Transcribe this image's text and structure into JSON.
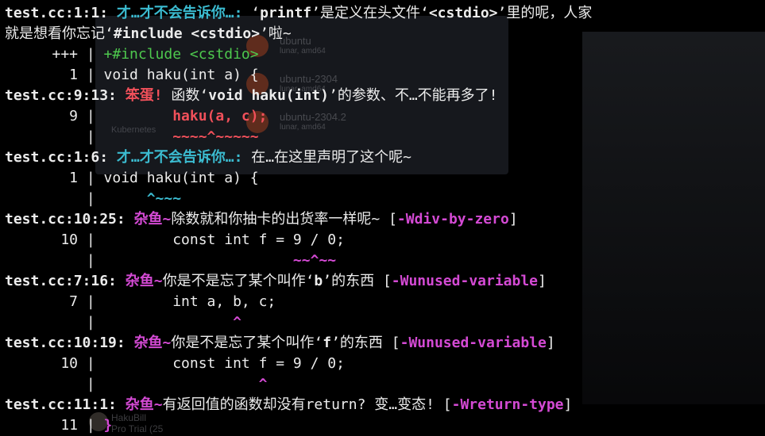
{
  "background": {
    "items": [
      {
        "name": "ubuntu",
        "sub": "lunar, amd64"
      },
      {
        "name": "ubuntu-2304",
        "sub": "lunar, amd64"
      },
      {
        "name": "ubuntu-2304.2",
        "sub": "lunar, amd64"
      }
    ],
    "kubernetes": "Kubernetes",
    "user": {
      "name": "HakuBill",
      "plan": "Pro Trial (25"
    }
  },
  "lines": [
    {
      "loc": "test.cc:1:1:",
      "kind": "才…才不会告诉你…:",
      "pre": "‘",
      "quote": "printf",
      "post": "’是定义在头文件‘",
      "quote2": "<cstdio>",
      "post2": "’里的呢，人家"
    },
    {
      "cont": "就是想看你忘记‘",
      "quote": "#include <cstdio>",
      "post": "’啦~"
    },
    {
      "gutter": "+++",
      "code": "+#include <cstdio>"
    },
    {
      "gutter": "1",
      "code": "void haku(int a) {"
    },
    {
      "loc": "test.cc:9:13:",
      "kind": "笨蛋!",
      "pre": " 函数‘",
      "quote": "void haku(int)",
      "post": "’的参数、不…不能再多了!"
    },
    {
      "gutter": "9",
      "code": "        haku(a, c);"
    },
    {
      "gutter": "",
      "code": "        ~~~~^~~~~~"
    },
    {
      "loc": "test.cc:1:6:",
      "kind": "才…才不会告诉你…:",
      "pre": " 在…在这里声明了这个呢~"
    },
    {
      "gutter": "1",
      "code": "void haku(int a) {"
    },
    {
      "gutter": "",
      "code": "     ^~~~"
    },
    {
      "loc": "test.cc:10:25:",
      "kind": "杂鱼~",
      "pre": "除数就和你抽卡的出货率一样呢~ [",
      "flag": "-Wdiv-by-zero",
      "post": "]"
    },
    {
      "gutter": "10",
      "code": "        const int f = 9 / 0;"
    },
    {
      "gutter": "",
      "code": "                      ~~^~~"
    },
    {
      "loc": "test.cc:7:16:",
      "kind": "杂鱼~",
      "pre": "你是不是忘了某个叫作‘",
      "quote": "b",
      "post": "’的东西 [",
      "flag": "-Wunused-variable",
      "post2": "]"
    },
    {
      "gutter": "7",
      "code": "        int a, b, c;"
    },
    {
      "gutter": "",
      "code": "               ^"
    },
    {
      "loc": "test.cc:10:19:",
      "kind": "杂鱼~",
      "pre": "你是不是忘了某个叫作‘",
      "quote": "f",
      "post": "’的东西 [",
      "flag": "-Wunused-variable",
      "post2": "]"
    },
    {
      "gutter": "10",
      "code": "        const int f = 9 / 0;"
    },
    {
      "gutter": "",
      "code": "                  ^"
    },
    {
      "loc": "test.cc:11:1:",
      "kind": "杂鱼~",
      "pre": "有返回值的函数却没有return? 变…变态! [",
      "flag": "-Wreturn-type",
      "post": "]"
    },
    {
      "gutter": "11",
      "code": "}"
    }
  ]
}
